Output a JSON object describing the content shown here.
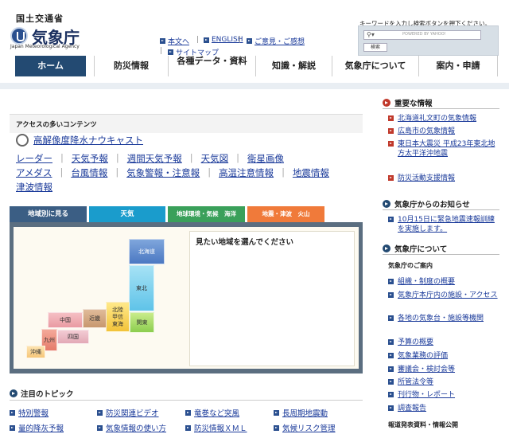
{
  "header": {
    "ministry": "国土交通省",
    "agency": "気象庁",
    "agency_en": "Japan Meteorological Agency",
    "links": [
      "本文へ",
      "ENGLISH",
      "ご意見・ご感想",
      "サイトマップ"
    ],
    "search_instructions": "キーワードを入力し検索ボタンを押下ください。",
    "search_powered": "POWERED BY YAHOO!",
    "search_button": "検索"
  },
  "nav": [
    "ホーム",
    "防災情報",
    "各種データ・資料",
    "知識・解説",
    "気象庁について",
    "案内・申請"
  ],
  "access": {
    "title": "アクセスの多いコンテンツ",
    "featured": "高解像度降水ナウキャスト",
    "row1": [
      "レーダー",
      "天気予報",
      "週間天気予報",
      "天気図",
      "衛星画像"
    ],
    "row2": [
      "アメダス",
      "台風情報",
      "気象警報・注意報",
      "高温注意情報",
      "地震情報"
    ],
    "row3": [
      "津波情報"
    ]
  },
  "tabs": [
    "地域別に見る",
    "天気",
    "地球環境・気候　海洋",
    "地震・津波　火山"
  ],
  "map": {
    "prompt": "見たい地域を選んでください",
    "regions": [
      "北海道",
      "東北",
      "北陸",
      "甲信",
      "東海",
      "関東",
      "近畿",
      "中国",
      "四国",
      "九州",
      "沖縄"
    ]
  },
  "topics": {
    "title": "注目のトピック",
    "items": [
      "特別警報",
      "防災関連ビデオ",
      "竜巻など突風",
      "長周期地震動",
      "量的降灰予報",
      "気象情報の使い方",
      "防災情報ＸＭＬ",
      "気候リスク管理"
    ]
  },
  "right": {
    "important_title": "重要な情報",
    "important_items": [
      "北海道礼文町の気象情報",
      "広島市の気象情報",
      "東日本大震災 平成23年東北地方太平洋沖地震",
      "防災活動支援情報"
    ],
    "notice_title": "気象庁からのお知らせ",
    "notice_items": [
      "10月15日に緊急地震速報訓練を実施します。"
    ],
    "about_title": "気象庁について",
    "about_sub": "気象庁のご案内",
    "about_items": [
      "組織・制度の概要",
      "気象庁本庁内の施設・アクセス",
      "各地の気象台・施設等機関",
      "予算の概要",
      "気象業務の評価",
      "審議会・検討会等",
      "所管法令等",
      "刊行物・レポート",
      "調査報告"
    ],
    "footer_label": "報道発表資料・情報公開"
  },
  "colors": {
    "nav_active": "#234a72",
    "tab_region": "#3b5e84",
    "tab_weather": "#1a9ccc",
    "tab_climate": "#3aa05a",
    "tab_quake": "#f07a3a",
    "accent_red": "#c0392b"
  }
}
